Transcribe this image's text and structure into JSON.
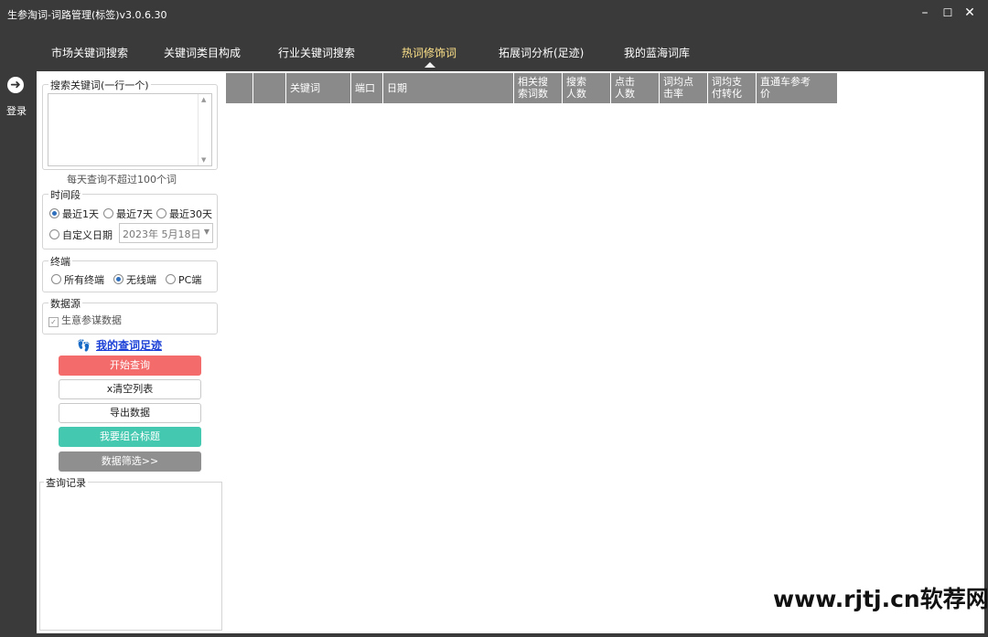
{
  "window": {
    "title": "生参淘词-词路管理(标签)v3.0.6.30",
    "min_icon": "minimize-icon",
    "max_icon": "maximize-icon",
    "close_icon": "close-icon"
  },
  "tabs": [
    {
      "label": "市场关键词搜索",
      "active": false
    },
    {
      "label": "关键词类目构成",
      "active": false
    },
    {
      "label": "行业关键词搜索",
      "active": false
    },
    {
      "label": "热词修饰词",
      "active": true
    },
    {
      "label": "拓展词分析(足迹)",
      "active": false
    },
    {
      "label": "我的蓝海词库",
      "active": false
    }
  ],
  "login": {
    "label": "登录",
    "icon": "arrow-right-circle-icon"
  },
  "search": {
    "legend": "搜索关键词(一行一个)",
    "value": "",
    "hint": "每天查询不超过100个词"
  },
  "period": {
    "legend": "时间段",
    "options": [
      "最近1天",
      "最近7天",
      "最近30天",
      "自定义日期"
    ],
    "selected": "最近1天",
    "date": "2023年 5月18日"
  },
  "terminal": {
    "legend": "终端",
    "options": [
      "所有终端",
      "无线端",
      "PC端"
    ],
    "selected": "无线端"
  },
  "datasource": {
    "legend": "数据源",
    "checkbox_label": "生意参谋数据",
    "checked": true
  },
  "history_link": {
    "label": "我的查词足迹",
    "icon": "footprint-icon"
  },
  "buttons": {
    "start": "开始查询",
    "clear": "x清空列表",
    "export": "导出数据",
    "combine": "我要组合标题",
    "filter": "数据筛选>>"
  },
  "query_log": {
    "legend": "查询记录"
  },
  "table": {
    "columns": [
      "",
      "",
      "关键词",
      "端口",
      "日期",
      "相关搜\n索词数",
      "搜索\n人数",
      "点击\n人数",
      "词均点\n击率",
      "词均支\n付转化",
      "直通车参考\n价"
    ],
    "rows": []
  },
  "watermark": "www.rjtj.cn软荐网"
}
